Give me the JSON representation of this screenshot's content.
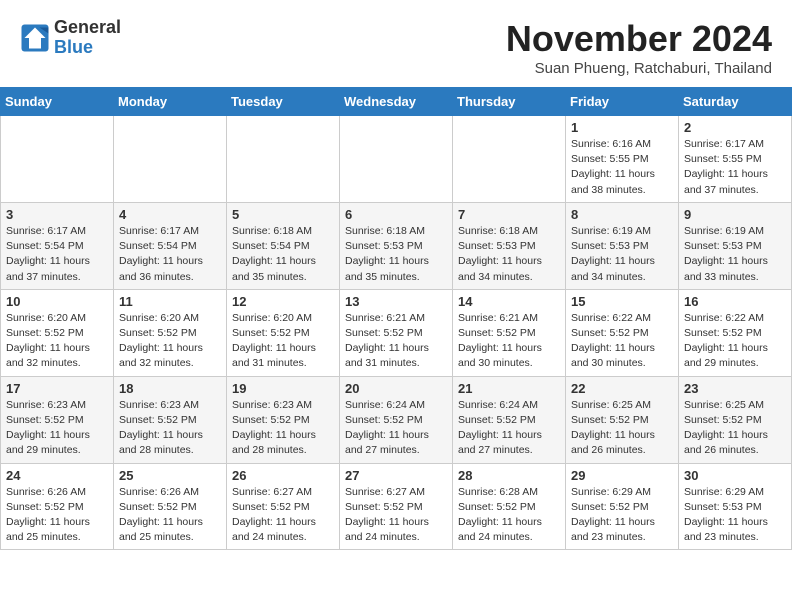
{
  "header": {
    "logo_general": "General",
    "logo_blue": "Blue",
    "month_title": "November 2024",
    "subtitle": "Suan Phueng, Ratchaburi, Thailand"
  },
  "days_of_week": [
    "Sunday",
    "Monday",
    "Tuesday",
    "Wednesday",
    "Thursday",
    "Friday",
    "Saturday"
  ],
  "weeks": [
    [
      {
        "day": "",
        "info": ""
      },
      {
        "day": "",
        "info": ""
      },
      {
        "day": "",
        "info": ""
      },
      {
        "day": "",
        "info": ""
      },
      {
        "day": "",
        "info": ""
      },
      {
        "day": "1",
        "info": "Sunrise: 6:16 AM\nSunset: 5:55 PM\nDaylight: 11 hours\nand 38 minutes."
      },
      {
        "day": "2",
        "info": "Sunrise: 6:17 AM\nSunset: 5:55 PM\nDaylight: 11 hours\nand 37 minutes."
      }
    ],
    [
      {
        "day": "3",
        "info": "Sunrise: 6:17 AM\nSunset: 5:54 PM\nDaylight: 11 hours\nand 37 minutes."
      },
      {
        "day": "4",
        "info": "Sunrise: 6:17 AM\nSunset: 5:54 PM\nDaylight: 11 hours\nand 36 minutes."
      },
      {
        "day": "5",
        "info": "Sunrise: 6:18 AM\nSunset: 5:54 PM\nDaylight: 11 hours\nand 35 minutes."
      },
      {
        "day": "6",
        "info": "Sunrise: 6:18 AM\nSunset: 5:53 PM\nDaylight: 11 hours\nand 35 minutes."
      },
      {
        "day": "7",
        "info": "Sunrise: 6:18 AM\nSunset: 5:53 PM\nDaylight: 11 hours\nand 34 minutes."
      },
      {
        "day": "8",
        "info": "Sunrise: 6:19 AM\nSunset: 5:53 PM\nDaylight: 11 hours\nand 34 minutes."
      },
      {
        "day": "9",
        "info": "Sunrise: 6:19 AM\nSunset: 5:53 PM\nDaylight: 11 hours\nand 33 minutes."
      }
    ],
    [
      {
        "day": "10",
        "info": "Sunrise: 6:20 AM\nSunset: 5:52 PM\nDaylight: 11 hours\nand 32 minutes."
      },
      {
        "day": "11",
        "info": "Sunrise: 6:20 AM\nSunset: 5:52 PM\nDaylight: 11 hours\nand 32 minutes."
      },
      {
        "day": "12",
        "info": "Sunrise: 6:20 AM\nSunset: 5:52 PM\nDaylight: 11 hours\nand 31 minutes."
      },
      {
        "day": "13",
        "info": "Sunrise: 6:21 AM\nSunset: 5:52 PM\nDaylight: 11 hours\nand 31 minutes."
      },
      {
        "day": "14",
        "info": "Sunrise: 6:21 AM\nSunset: 5:52 PM\nDaylight: 11 hours\nand 30 minutes."
      },
      {
        "day": "15",
        "info": "Sunrise: 6:22 AM\nSunset: 5:52 PM\nDaylight: 11 hours\nand 30 minutes."
      },
      {
        "day": "16",
        "info": "Sunrise: 6:22 AM\nSunset: 5:52 PM\nDaylight: 11 hours\nand 29 minutes."
      }
    ],
    [
      {
        "day": "17",
        "info": "Sunrise: 6:23 AM\nSunset: 5:52 PM\nDaylight: 11 hours\nand 29 minutes."
      },
      {
        "day": "18",
        "info": "Sunrise: 6:23 AM\nSunset: 5:52 PM\nDaylight: 11 hours\nand 28 minutes."
      },
      {
        "day": "19",
        "info": "Sunrise: 6:23 AM\nSunset: 5:52 PM\nDaylight: 11 hours\nand 28 minutes."
      },
      {
        "day": "20",
        "info": "Sunrise: 6:24 AM\nSunset: 5:52 PM\nDaylight: 11 hours\nand 27 minutes."
      },
      {
        "day": "21",
        "info": "Sunrise: 6:24 AM\nSunset: 5:52 PM\nDaylight: 11 hours\nand 27 minutes."
      },
      {
        "day": "22",
        "info": "Sunrise: 6:25 AM\nSunset: 5:52 PM\nDaylight: 11 hours\nand 26 minutes."
      },
      {
        "day": "23",
        "info": "Sunrise: 6:25 AM\nSunset: 5:52 PM\nDaylight: 11 hours\nand 26 minutes."
      }
    ],
    [
      {
        "day": "24",
        "info": "Sunrise: 6:26 AM\nSunset: 5:52 PM\nDaylight: 11 hours\nand 25 minutes."
      },
      {
        "day": "25",
        "info": "Sunrise: 6:26 AM\nSunset: 5:52 PM\nDaylight: 11 hours\nand 25 minutes."
      },
      {
        "day": "26",
        "info": "Sunrise: 6:27 AM\nSunset: 5:52 PM\nDaylight: 11 hours\nand 24 minutes."
      },
      {
        "day": "27",
        "info": "Sunrise: 6:27 AM\nSunset: 5:52 PM\nDaylight: 11 hours\nand 24 minutes."
      },
      {
        "day": "28",
        "info": "Sunrise: 6:28 AM\nSunset: 5:52 PM\nDaylight: 11 hours\nand 24 minutes."
      },
      {
        "day": "29",
        "info": "Sunrise: 6:29 AM\nSunset: 5:52 PM\nDaylight: 11 hours\nand 23 minutes."
      },
      {
        "day": "30",
        "info": "Sunrise: 6:29 AM\nSunset: 5:53 PM\nDaylight: 11 hours\nand 23 minutes."
      }
    ]
  ]
}
